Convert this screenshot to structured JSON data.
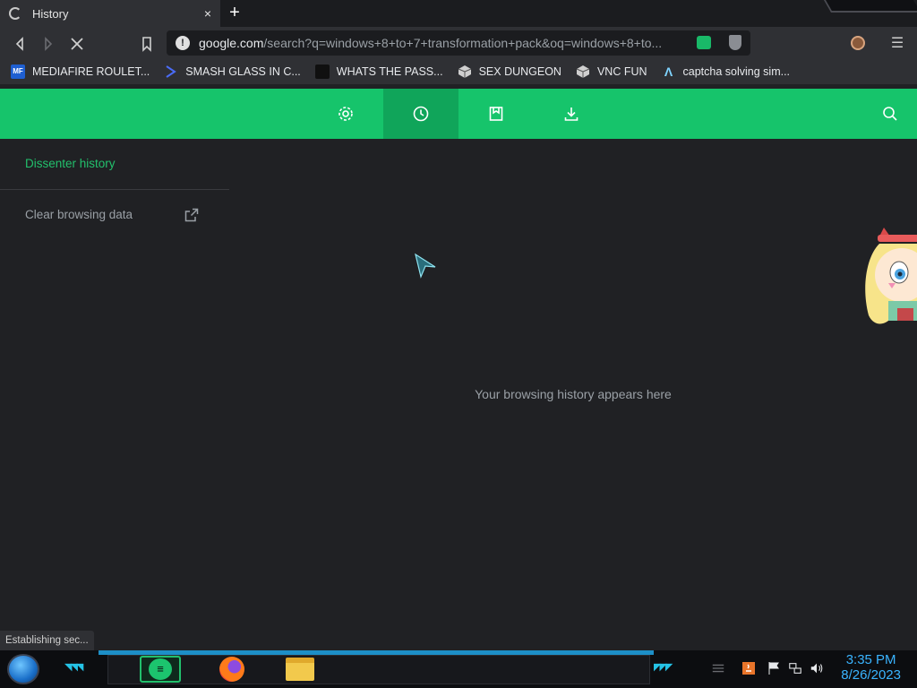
{
  "tab": {
    "title": "History",
    "close": "×",
    "new_tab": "+"
  },
  "toolbar": {
    "url_host": "google.com",
    "url_path": "/search?q=windows+8+to+7+transformation+pack&oq=windows+8+to..."
  },
  "bookmarks": [
    {
      "label": "MEDIAFIRE ROULET...",
      "icon": "mf-icon",
      "color": "#1f5fd1",
      "glyph": "MF"
    },
    {
      "label": "SMASH GLASS IN C...",
      "icon": "chevron-icon",
      "color": "#2f3034",
      "glyph": ""
    },
    {
      "label": "WHATS THE PASS...",
      "icon": "site-icon",
      "color": "#101010",
      "glyph": ""
    },
    {
      "label": "SEX DUNGEON",
      "icon": "cube-icon",
      "color": "#2f3034",
      "glyph": ""
    },
    {
      "label": "VNC FUN",
      "icon": "cube-icon",
      "color": "#2f3034",
      "glyph": ""
    },
    {
      "label": "captcha solving sim...",
      "icon": "lambda-icon",
      "color": "#2f3034",
      "glyph": "Λ"
    }
  ],
  "dissenter": {
    "sidebar_title": "Dissenter history",
    "clear_label": "Clear browsing data",
    "empty_message": "Your browsing history appears here",
    "accent": "#16c46b",
    "active_tab": "history"
  },
  "status_text": "Establishing sec...",
  "clock": {
    "time": "3:35 PM",
    "date": "8/26/2023"
  }
}
